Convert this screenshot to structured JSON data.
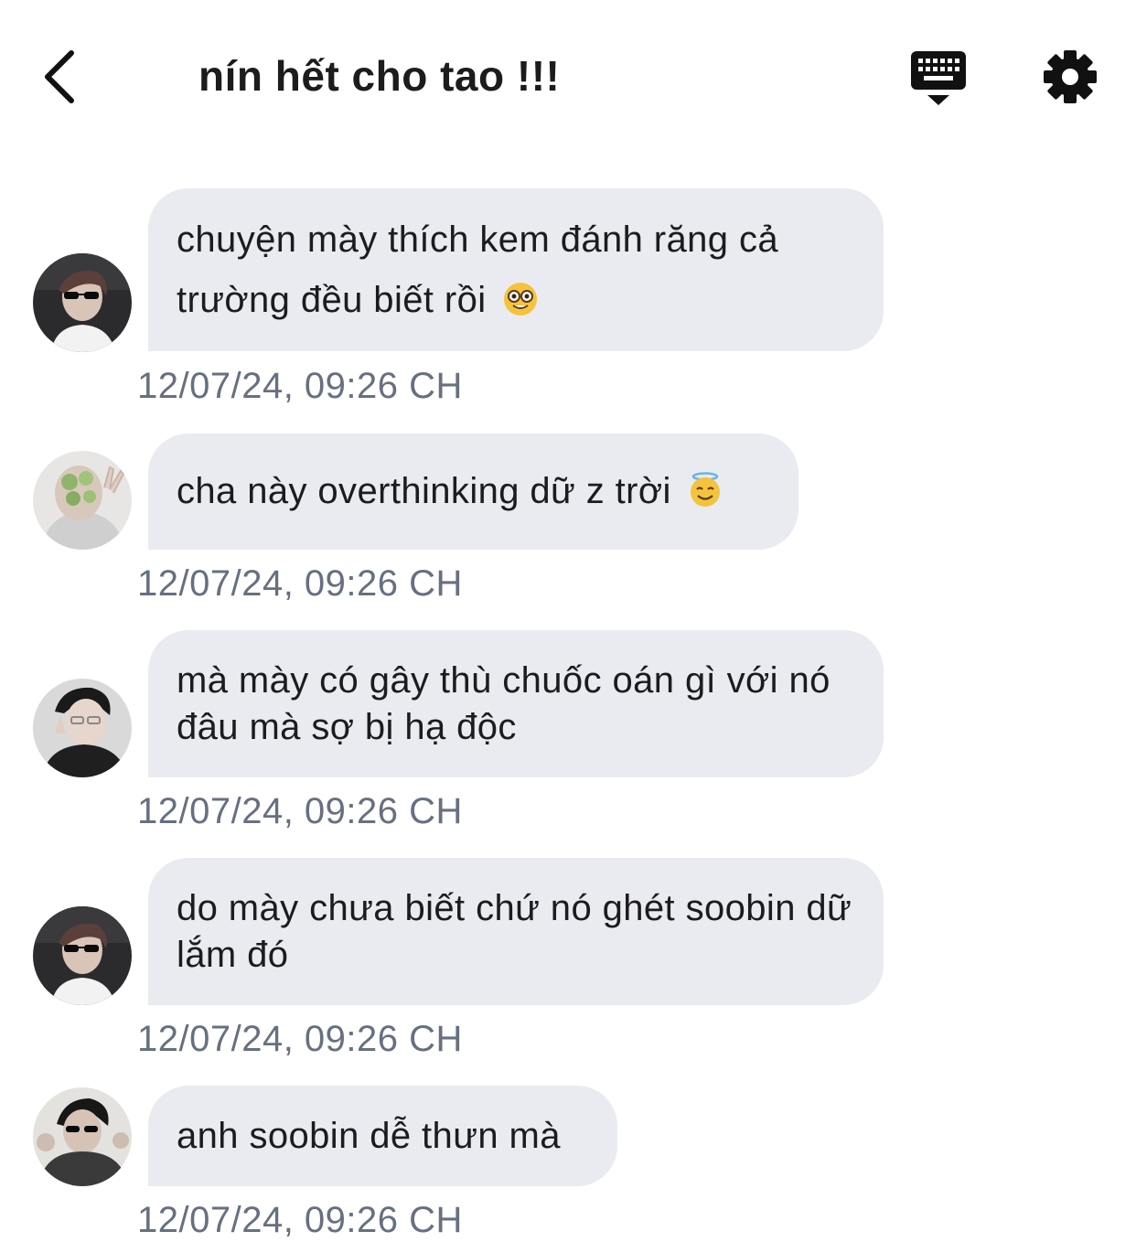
{
  "header": {
    "title": "nín hết cho tao !!!",
    "back_icon": "chevron-left-icon",
    "keyboard_icon": "keyboard-hide-icon",
    "settings_icon": "gear-icon"
  },
  "colors": {
    "bubble_bg": "#e9ebf0",
    "timestamp": "#667080",
    "text": "#1c1c1e"
  },
  "messages": [
    {
      "text": "chuyện mày thích kem đánh răng cả trường đều biết rồi",
      "emoji": "nerd-face-emoji",
      "time": "12/07/24, 09:26 CH"
    },
    {
      "text": "cha này overthinking dữ z trời",
      "emoji": "smiling-face-with-halo-emoji",
      "time": "12/07/24, 09:26 CH"
    },
    {
      "text": "mà mày có gây thù chuốc oán gì với nó đâu mà sợ bị hạ độc",
      "emoji": "",
      "time": "12/07/24, 09:26 CH"
    },
    {
      "text": "do mày chưa biết chứ nó ghét soobin dữ lắm đó",
      "emoji": "",
      "time": "12/07/24, 09:26 CH"
    },
    {
      "text": "anh soobin dễ thưn mà",
      "emoji": "",
      "time": "12/07/24, 09:26 CH"
    }
  ]
}
